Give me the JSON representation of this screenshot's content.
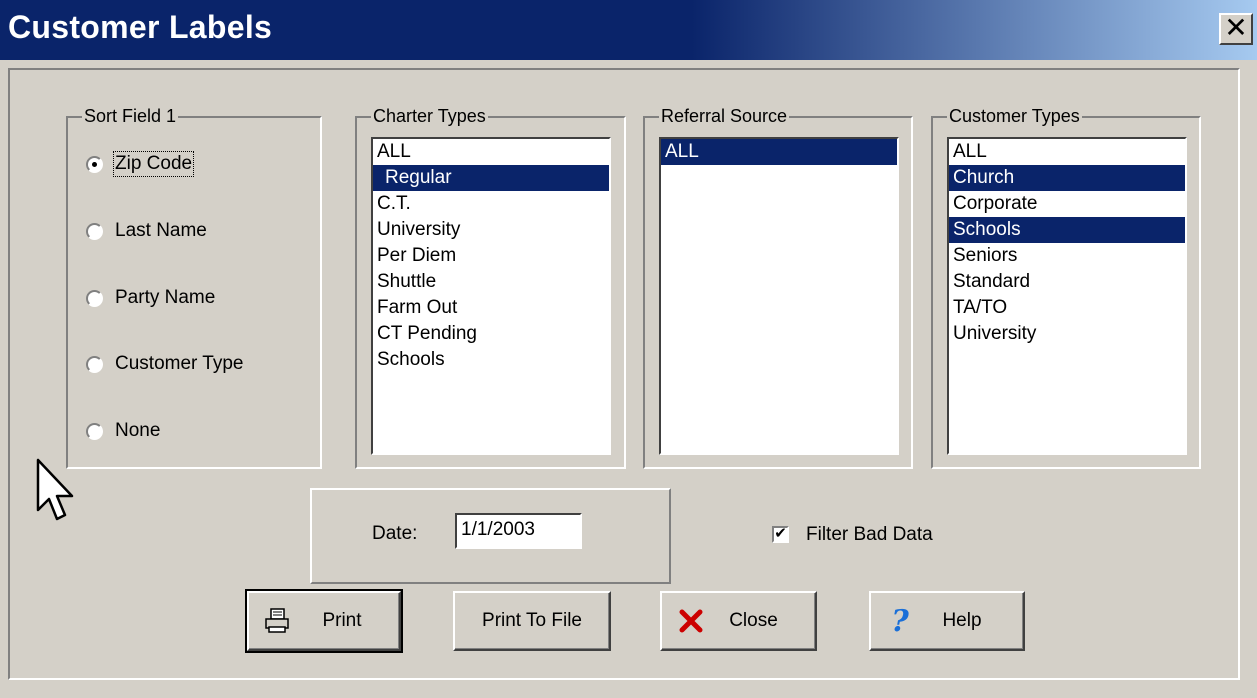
{
  "window": {
    "title": "Customer Labels",
    "close_glyph": "✕"
  },
  "sort_field": {
    "title": "Sort Field 1",
    "options": [
      "Zip Code",
      "Last Name",
      "Party Name",
      "Customer Type",
      "None"
    ],
    "selected": "Zip Code"
  },
  "charter_types": {
    "title": "Charter Types",
    "items": [
      "ALL",
      "Regular",
      "C.T.",
      "University",
      "Per Diem",
      "Shuttle",
      "Farm Out",
      "CT Pending",
      "Schools"
    ],
    "selected": [
      "Regular"
    ]
  },
  "referral_source": {
    "title": "Referral Source",
    "items": [
      "ALL"
    ],
    "selected": [
      "ALL"
    ]
  },
  "customer_types": {
    "title": "Customer Types",
    "items": [
      "ALL",
      "Church",
      "Corporate",
      "Schools",
      "Seniors",
      "Standard",
      "TA/TO",
      "University"
    ],
    "selected": [
      "Church",
      "Schools"
    ]
  },
  "date": {
    "label": "Date:",
    "value": "1/1/2003"
  },
  "filter_bad_data": {
    "label": "Filter Bad Data",
    "checked": true
  },
  "buttons": {
    "print": "Print",
    "print_to_file": "Print To File",
    "close": "Close",
    "help": "Help"
  },
  "colors": {
    "title_bar": "#0a246a",
    "selection": "#0a246a",
    "face": "#d4d0c8",
    "close_icon": "#cc0000",
    "help_icon": "#1a6fd8"
  }
}
